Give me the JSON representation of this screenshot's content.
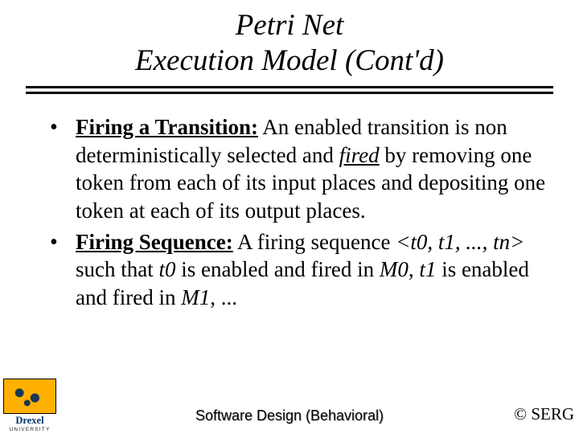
{
  "title": {
    "line1": "Petri Net",
    "line2": "Execution Model (Cont'd)"
  },
  "bullets": [
    {
      "term": "Firing a Transition:",
      "body_html": "  An enabled transition is non deterministically selected and <span class='emu'>fired</span> by removing one token from each of its input places and depositing one token at each of its output places."
    },
    {
      "term": "Firing Sequence:",
      "body_html": " A firing sequence <span class='em'>&lt;t0, t1, ..., tn&gt;</span> such that <span class='em'>t0</span> is enabled and fired in <span class='em'>M0</span>, <span class='em'>t1</span> is enabled and fired in <span class='em'>M1</span>, ..."
    }
  ],
  "logo": {
    "name": "Drexel",
    "subtitle": "UNIVERSITY"
  },
  "footer": {
    "center": "Software Design (Behavioral)",
    "right": "© SERG"
  }
}
